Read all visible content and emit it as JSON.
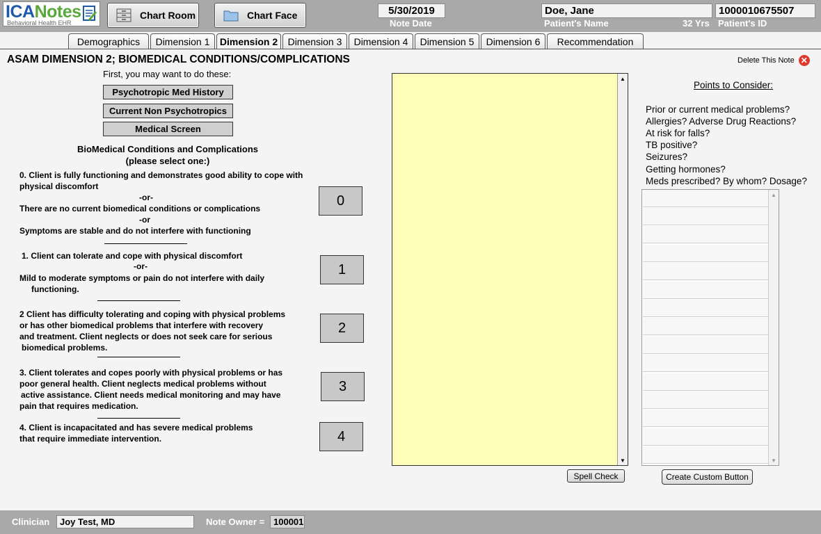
{
  "brand": {
    "name_blue": "ICA",
    "name_green": "Notes",
    "tagline": "Behavioral Health EHR"
  },
  "header": {
    "chart_room_label": "Chart Room",
    "chart_face_label": "Chart Face",
    "note_date": "5/30/2019",
    "note_date_label": "Note Date",
    "patient_name": "Doe, Jane",
    "patient_name_label": "Patient's Name",
    "patient_age": "32 Yrs",
    "patient_id": "1000010675507",
    "patient_id_label": "Patient's ID"
  },
  "tabs": [
    "Demographics",
    "Dimension 1",
    "Dimension 2",
    "Dimension 3",
    "Dimension 4",
    "Dimension 5",
    "Dimension 6",
    "Recommendation"
  ],
  "active_tab": "Dimension 2",
  "page": {
    "title": "ASAM DIMENSION 2; BIOMEDICAL CONDITIONS/COMPLICATIONS",
    "delete_label": "Delete This Note",
    "intro": "First, you may want to do these:",
    "buttons": [
      "Psychotropic Med History",
      "Current Non Psychotropics",
      "Medical Screen"
    ],
    "bio_heading": "BioMedical Conditions and Complications",
    "bio_subheading": "(please select one:)"
  },
  "options": {
    "o0": {
      "line1": "0. Client is fully functioning and demonstrates good ability to cope with",
      "line2": "physical discomfort",
      "or1": "-or-",
      "line3": "There are no current biomedical conditions or complications",
      "or2": "-or",
      "line4": "Symptoms are stable and do not interfere with functioning",
      "button": "0"
    },
    "o1": {
      "line1": "1. Client can tolerate and cope with physical discomfort",
      "or1": "-or-",
      "line2": "Mild to moderate symptoms or pain do not interfere with daily",
      "line3": "functioning.",
      "button": "1"
    },
    "o2": {
      "line1": "2  Client has difficulty tolerating and coping with physical problems",
      "line2": "or has other biomedical problems that interfere with recovery",
      "line3": "and treatment. Client neglects or does not seek care for serious",
      "line4": "biomedical problems.",
      "button": "2"
    },
    "o3": {
      "line1": "3. Client tolerates and copes poorly with physical problems or has",
      "line2": "poor general health. Client neglects medical problems without",
      "line3": "active assistance. Client needs medical monitoring and may have",
      "line4": "pain that requires medication.",
      "button": "3"
    },
    "o4": {
      "line1": "4. Client is incapacitated and has severe medical problems",
      "line2": "that require immediate intervention.",
      "button": "4"
    }
  },
  "note": {
    "text": "",
    "spell_check_label": "Spell Check"
  },
  "points": {
    "heading": "Points to Consider:",
    "items": [
      "Prior or current medical problems?",
      "Allergies? Adverse Drug Reactions?",
      "At risk for falls?",
      "TB positive?",
      "Seizures?",
      "Getting hormones?",
      "Meds prescribed? By whom? Dosage?"
    ],
    "create_button_label": "Create Custom Button"
  },
  "footer": {
    "clinician_label": "Clinician",
    "clinician_value": "Joy Test, MD",
    "owner_label": "Note Owner =",
    "owner_value": "100001"
  },
  "colors": {
    "header_bg": "#a9a9a9",
    "note_bg": "#fefeb8",
    "delete_red": "#e03a2e",
    "brand_blue": "#1e5aa8",
    "brand_green": "#5aa83c"
  }
}
